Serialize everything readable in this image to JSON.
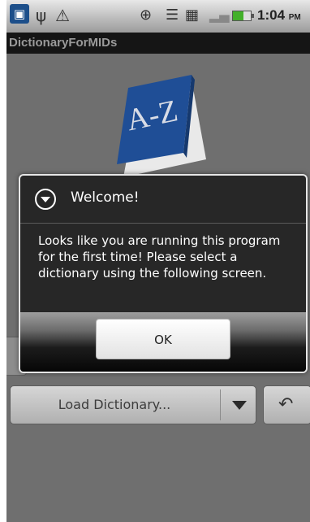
{
  "status_bar": {
    "time": "1:04",
    "time_suffix": "PM",
    "battery_level": 0.6,
    "icons": [
      "photo-icon",
      "usb-icon",
      "warning-icon",
      "gps-icon",
      "wifi-icon",
      "data-sync-icon",
      "signal-icon",
      "battery-icon"
    ]
  },
  "app": {
    "title": "DictionaryForMIDs"
  },
  "logo": {
    "text": "A-Z"
  },
  "main": {
    "dictionary_spinner_label": "Load Dictionary...",
    "icons": [
      "dropdown-arrow-icon",
      "undo-icon"
    ]
  },
  "dialog": {
    "title": "Welcome!",
    "message": "Looks like you are running this program for the first time! Please select a dictionary using the following screen.",
    "ok_label": "OK",
    "icon": "info-dropdown-icon"
  },
  "colors": {
    "background": "#6f6f6f",
    "dialog_background": "#272727",
    "title_bar": "#151515",
    "book_cover": "#1f4e96"
  }
}
